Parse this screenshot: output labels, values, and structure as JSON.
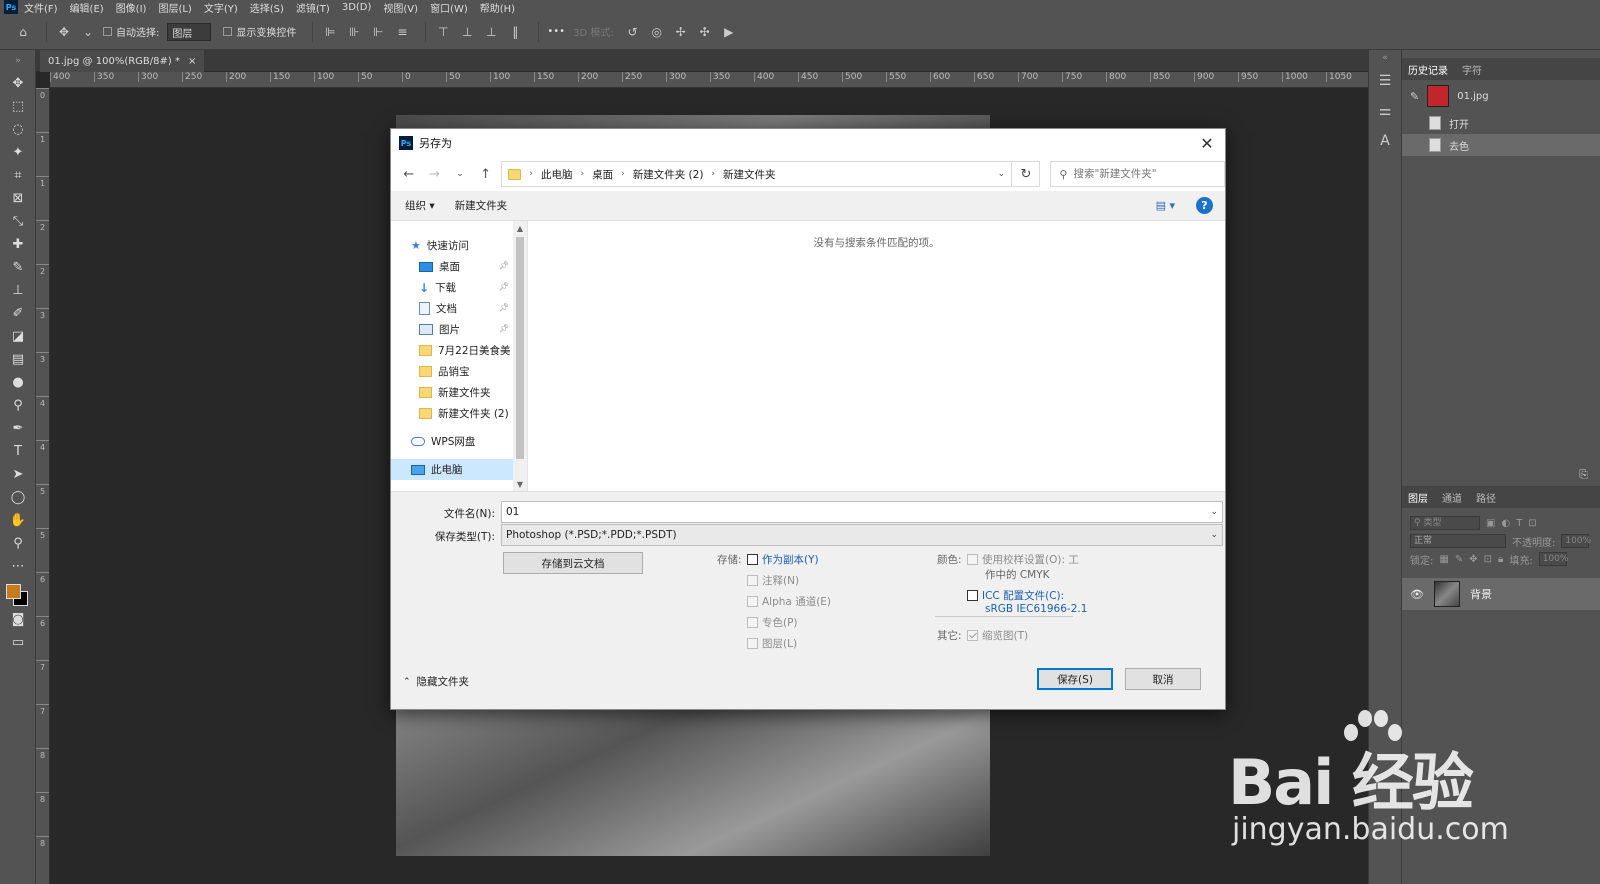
{
  "menu": [
    "文件(F)",
    "编辑(E)",
    "图像(I)",
    "图层(L)",
    "文字(Y)",
    "选择(S)",
    "滤镜(T)",
    "3D(D)",
    "视图(V)",
    "窗口(W)",
    "帮助(H)"
  ],
  "ps_logo": "Ps",
  "options": {
    "auto_select": "自动选择:",
    "layer_select": "图层",
    "show_transform": "显示变换控件",
    "more": "•••",
    "mode_3d": "3D 模式:"
  },
  "doc_tab": {
    "title": "01.jpg @ 100%(RGB/8#) *",
    "close": "×"
  },
  "ruler_top": [
    "400",
    "350",
    "300",
    "250",
    "200",
    "150",
    "100",
    "50",
    "0",
    "50",
    "100",
    "150",
    "200",
    "250",
    "300",
    "350",
    "400",
    "450",
    "500",
    "550",
    "600",
    "650",
    "700",
    "750",
    "800",
    "850",
    "900",
    "950",
    "1000",
    "1050"
  ],
  "ruler_left": [
    "0",
    "1",
    "1",
    "2",
    "2",
    "3",
    "3",
    "4",
    "4",
    "5",
    "5",
    "6",
    "6",
    "7",
    "7",
    "8",
    "8",
    "8"
  ],
  "history_panel": {
    "tabs": [
      "历史记录",
      "字符"
    ],
    "snapshot": "01.jpg",
    "items": [
      "打开",
      "去色"
    ]
  },
  "layers_panel": {
    "tabs": [
      "图层",
      "通道",
      "路径"
    ],
    "kind_label": "类型",
    "blend_mode": "正常",
    "opacity_label": "不透明度:",
    "opacity_value": "100%",
    "lock_label": "锁定:",
    "fill_label": "填充:",
    "fill_value": "100%",
    "layer_name": "背景"
  },
  "dialog": {
    "title": "另存为",
    "close": "✕",
    "breadcrumb": [
      "此电脑",
      "桌面",
      "新建文件夹 (2)",
      "新建文件夹"
    ],
    "search_placeholder": "搜索\"新建文件夹\"",
    "organize": "组织 ▾",
    "new_folder": "新建文件夹",
    "help": "?",
    "view_icon": "▤ ▾",
    "empty_message": "没有与搜索条件匹配的项。",
    "nav": [
      {
        "label": "快速访问",
        "icon": "star-icon",
        "level": 1
      },
      {
        "label": "桌面",
        "icon": "desktop-icon",
        "level": 2,
        "pin": true
      },
      {
        "label": "下载",
        "icon": "download-icon",
        "level": 2,
        "pin": true
      },
      {
        "label": "文档",
        "icon": "document-icon",
        "level": 2,
        "pin": true
      },
      {
        "label": "图片",
        "icon": "pictures-icon",
        "level": 2,
        "pin": true
      },
      {
        "label": "7月22日美食美",
        "icon": "folder-icon",
        "level": 2
      },
      {
        "label": "品销宝",
        "icon": "folder-icon",
        "level": 2
      },
      {
        "label": "新建文件夹",
        "icon": "folder-icon",
        "level": 2
      },
      {
        "label": "新建文件夹 (2)",
        "icon": "folder-icon",
        "level": 2
      },
      {
        "label": "WPS网盘",
        "icon": "cloud-icon",
        "level": 1
      },
      {
        "label": "此电脑",
        "icon": "computer-icon",
        "level": 1,
        "selected": true
      }
    ],
    "filename_label": "文件名(N):",
    "filename_value": "01",
    "filetype_label": "保存类型(T):",
    "filetype_value": "Photoshop (*.PSD;*.PDD;*.PSDT)",
    "cloud_button": "存储到云文档",
    "storage_label": "存储:",
    "storage_options": [
      {
        "label": "作为副本(Y)",
        "enabled": true,
        "checked": false
      },
      {
        "label": "注释(N)",
        "enabled": false
      },
      {
        "label": "Alpha 通道(E)",
        "enabled": false
      },
      {
        "label": "专色(P)",
        "enabled": false
      },
      {
        "label": "图层(L)",
        "enabled": false
      }
    ],
    "color_label": "颜色:",
    "proof_setup": "使用校样设置(O):  工",
    "proof_sub": "作中的 CMYK",
    "icc_label": "ICC 配置文件(C):",
    "icc_sub": "sRGB IEC61966-2.1",
    "other_label": "其它:",
    "thumbnail": "缩览图(T)",
    "hide_folders": "隐藏文件夹",
    "save": "保存(S)",
    "cancel": "取消"
  },
  "watermark": {
    "logo": "Bai  经验",
    "url": "jingyan.baidu.com"
  },
  "colors": {
    "foreground": "#c87a1e",
    "background": "#000000",
    "accent": "#0078d7"
  }
}
